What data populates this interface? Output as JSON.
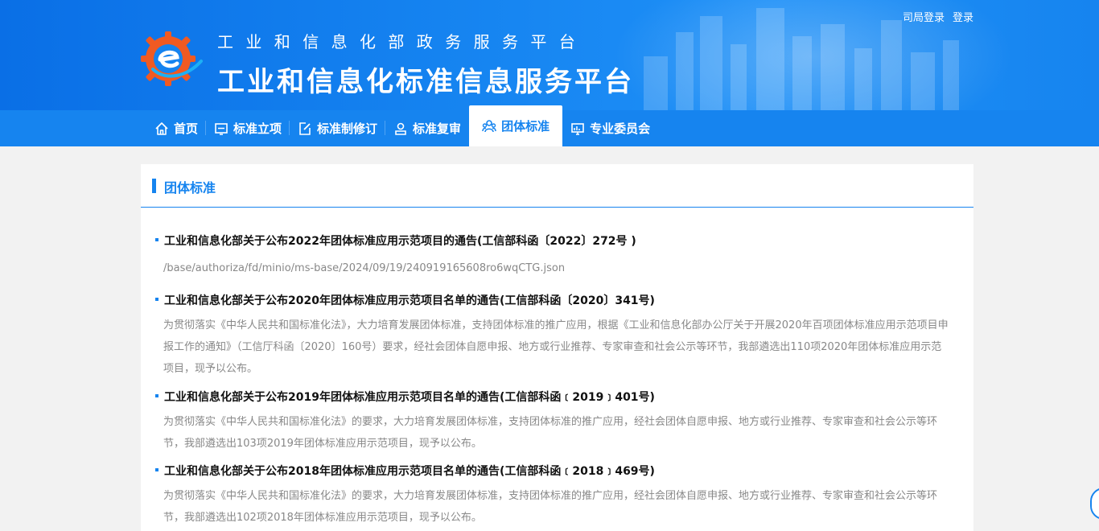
{
  "header": {
    "subtitle": "工业和信息化部政务服务平台",
    "title": "工业和信息化标准信息服务平台",
    "links": [
      "司局登录",
      "登录"
    ]
  },
  "nav": {
    "items": [
      {
        "label": "首页",
        "icon": "home-icon"
      },
      {
        "label": "标准立项",
        "icon": "form-icon"
      },
      {
        "label": "标准制修订",
        "icon": "edit-doc-icon"
      },
      {
        "label": "标准复审",
        "icon": "review-icon"
      },
      {
        "label": "团体标准",
        "icon": "group-icon",
        "active": true
      },
      {
        "label": "专业委员会",
        "icon": "committee-icon"
      }
    ]
  },
  "panel": {
    "title": "团体标准",
    "notices": [
      {
        "title": "工业和信息化部关于公布2022年团体标准应用示范项目的通告(工信部科函〔2022〕272号 )",
        "desc": "/base/authoriza/fd/minio/ms-base/2024/09/19/240919165608ro6wqCTG.json"
      },
      {
        "title": "工业和信息化部关于公布2020年团体标准应用示范项目名单的通告(工信部科函〔2020〕341号)",
        "desc": "为贯彻落实《中华人民共和国标准化法》，大力培育发展团体标准，支持团体标准的推广应用，根据《工业和信息化部办公厅关于开展2020年百项团体标准应用示范项目申报工作的通知》（工信厅科函〔2020〕160号）要求，经社会团体自愿申报、地方或行业推荐、专家审查和社会公示等环节，我部遴选出110项2020年团体标准应用示范项目，现予以公布。"
      },
      {
        "title": "工业和信息化部关于公布2019年团体标准应用示范项目名单的通告(工信部科函﹝2019﹞401号)",
        "desc": "为贯彻落实《中华人民共和国标准化法》的要求，大力培育发展团体标准，支持团体标准的推广应用，经社会团体自愿申报、地方或行业推荐、专家审查和社会公示等环节，我部遴选出103项2019年团体标准应用示范项目，现予以公布。"
      },
      {
        "title": "工业和信息化部关于公布2018年团体标准应用示范项目名单的通告(工信部科函﹝2018﹞469号)",
        "desc": "为贯彻落实《中华人民共和国标准化法》的要求，大力培育发展团体标准，支持团体标准的推广应用，经社会团体自愿申报、地方或行业推荐、专家审查和社会公示等环节，我部遴选出102项2018年团体标准应用示范项目，现予以公布。"
      }
    ]
  },
  "colors": {
    "primary": "#1684ef",
    "logo_orange": "#f05a22",
    "text_dark": "#111111",
    "text_muted": "#888888",
    "background": "#f2f2f2"
  }
}
